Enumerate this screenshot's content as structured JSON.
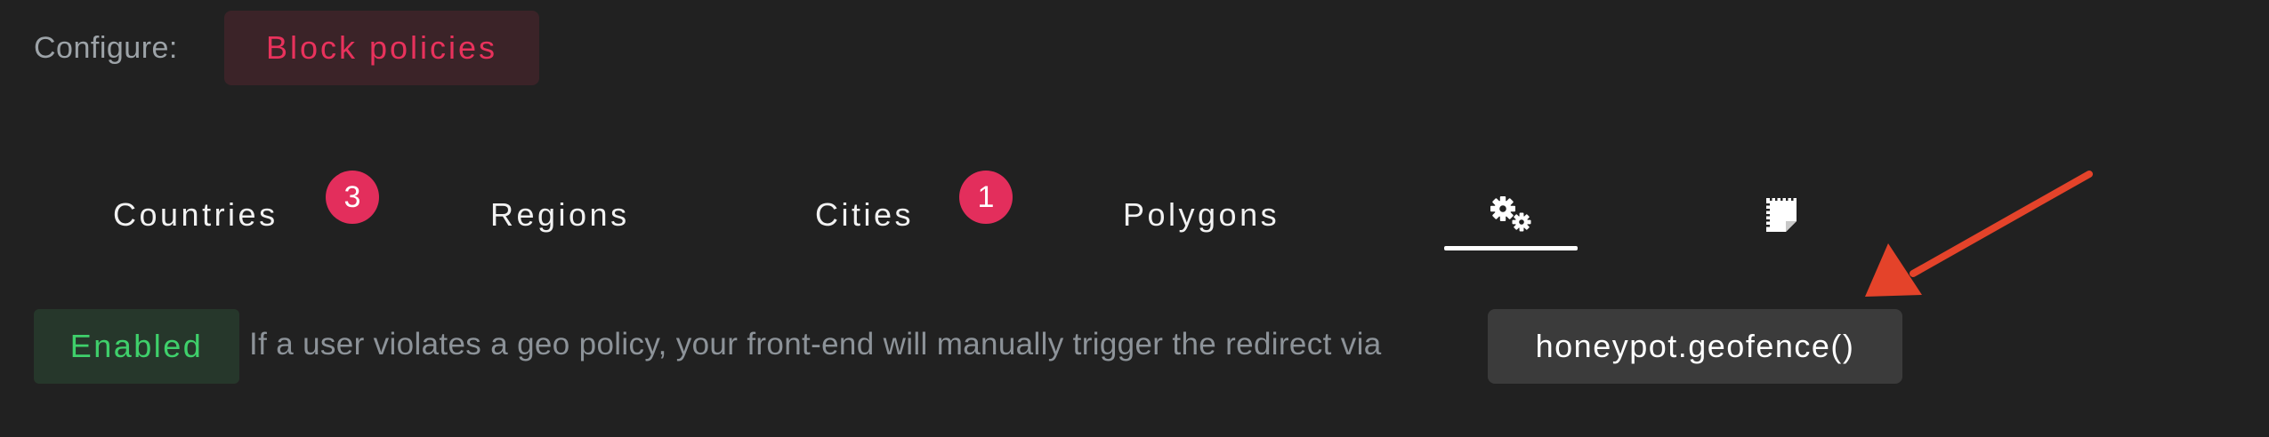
{
  "configure": {
    "label": "Configure:",
    "button_label": "Block policies"
  },
  "tabs": [
    {
      "label": "Countries",
      "badge": "3"
    },
    {
      "label": "Regions"
    },
    {
      "label": "Cities",
      "badge": "1"
    },
    {
      "label": "Polygons"
    },
    {
      "icon": "gears-icon",
      "active": true
    },
    {
      "icon": "notepad-icon"
    }
  ],
  "status": {
    "badge_label": "Enabled",
    "description": "If a user violates a geo policy, your front-end will manually trigger the redirect via",
    "code": "honeypot.geofence()"
  },
  "colors": {
    "background": "#212121",
    "accent_pink": "#e32e5c",
    "enabled_green": "#3fd06b",
    "annotation_arrow": "#e4432a"
  }
}
